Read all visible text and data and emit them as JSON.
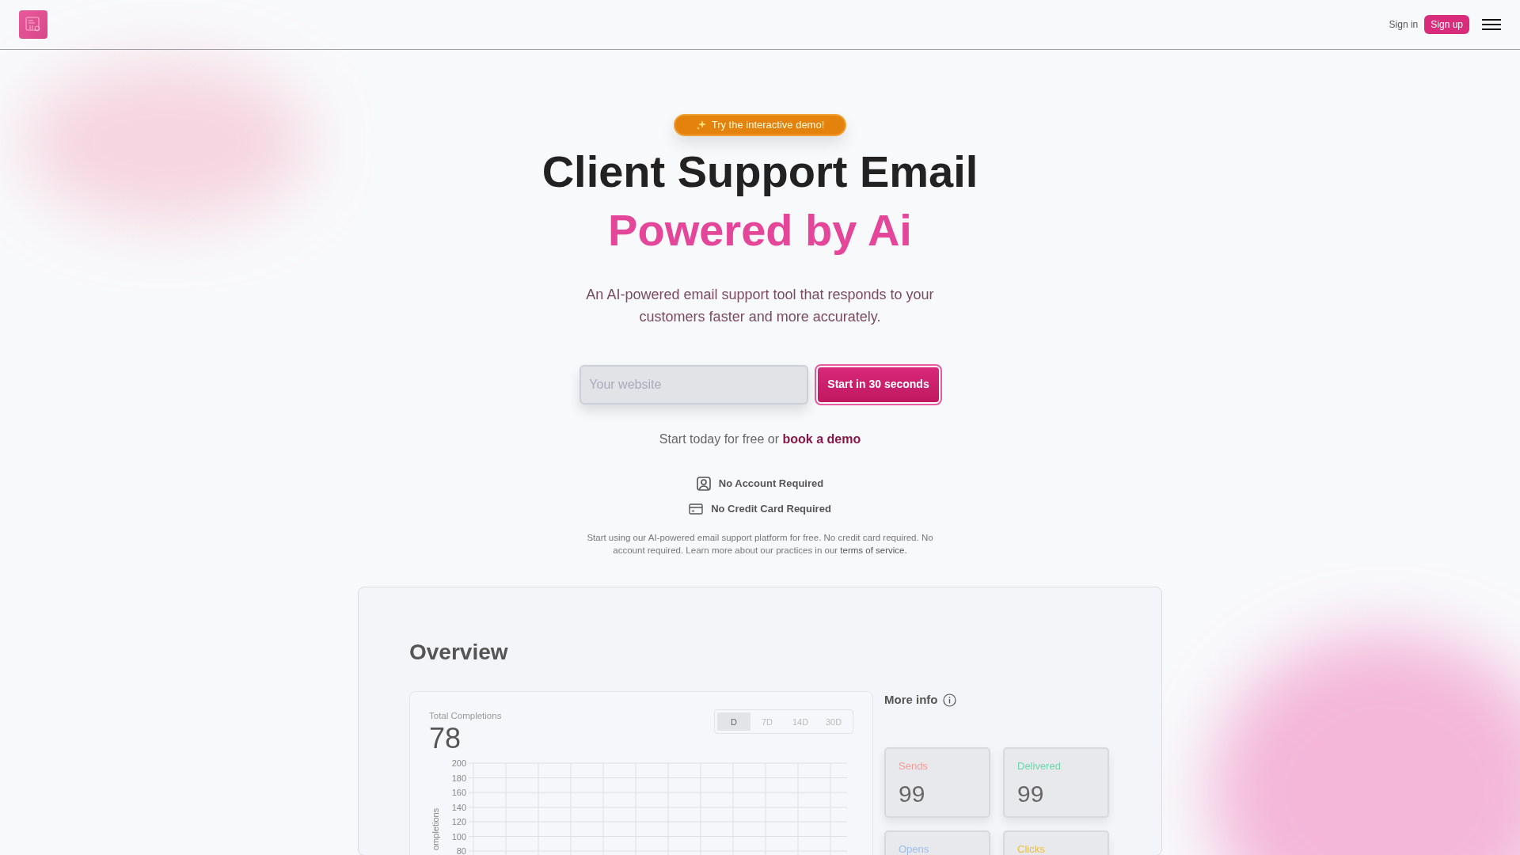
{
  "nav": {
    "sign_in": "Sign in",
    "sign_up": "Sign up"
  },
  "hero": {
    "badge": "Try the interactive demo!",
    "title": "Client Support Email",
    "title_highlight": "Powered by Ai",
    "subtitle": "An AI-powered email support tool that responds to your customers faster and more accurately.",
    "website_field": {
      "placeholder": "Your website"
    },
    "start_button": "Start in 30 seconds",
    "cta_text": "Start today for free or ",
    "cta_link": "book a demo",
    "features": [
      {
        "kind": "account",
        "label": "No Account Required"
      },
      {
        "kind": "card",
        "label": "No Credit Card Required"
      }
    ],
    "fine_print": "Start using our AI-powered email support platform for free. No credit card required. No account required. Learn more about our practices in our ",
    "fine_print_link": "terms of service."
  },
  "overview": {
    "title": "Overview",
    "chart_panel": {
      "label": "Total Completions",
      "value": "78",
      "ranges": [
        {
          "label": "D",
          "selected": true
        },
        {
          "label": "7D",
          "selected": false
        },
        {
          "label": "14D",
          "selected": false
        },
        {
          "label": "30D",
          "selected": false
        }
      ],
      "axis_title": "ompletions",
      "axis_labels": [
        "200",
        "180",
        "160",
        "140",
        "120",
        "100",
        "80"
      ]
    },
    "more_info": {
      "title": "More info",
      "stats": [
        {
          "label": "Sends",
          "value": "99",
          "color": "#f29a9a"
        },
        {
          "label": "Delivered",
          "value": "99",
          "color": "#6fd6aa"
        },
        {
          "label": "Opens",
          "color": "#9dbdf2"
        },
        {
          "label": "Clicks",
          "color": "#e8bf45"
        }
      ]
    }
  }
}
